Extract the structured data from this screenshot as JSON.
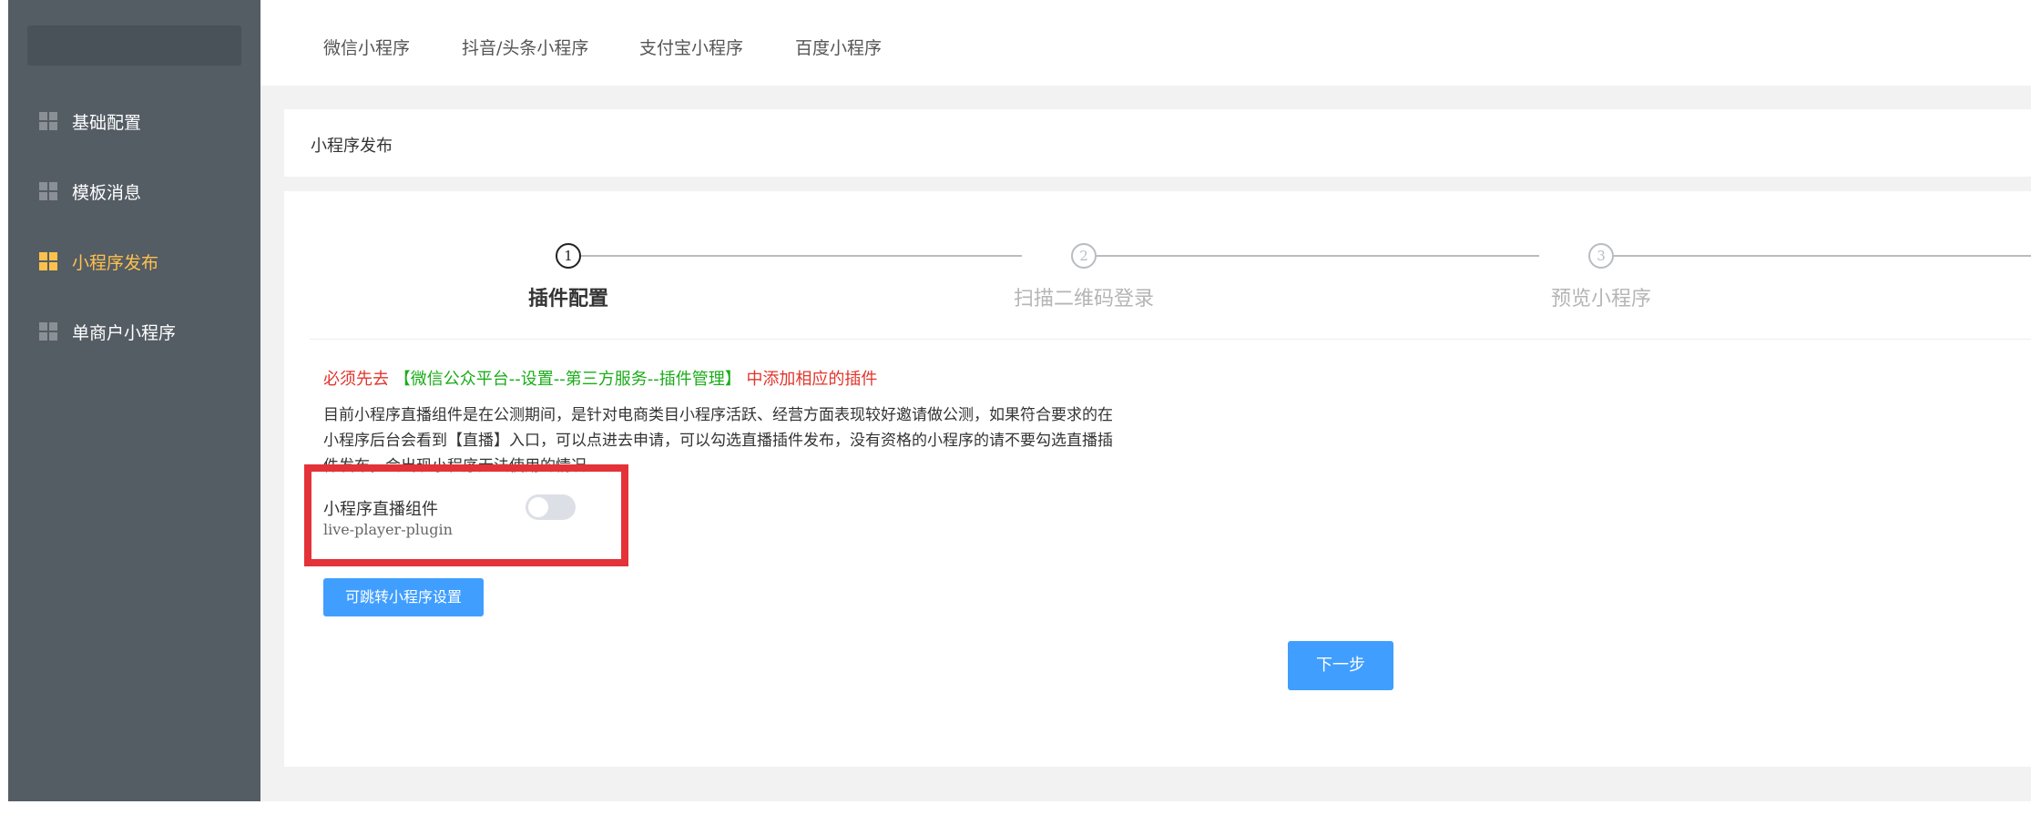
{
  "sidebar": {
    "items": [
      {
        "label": "基础配置"
      },
      {
        "label": "模板消息"
      },
      {
        "label": "小程序发布"
      },
      {
        "label": "单商户小程序"
      }
    ],
    "active_index": 2
  },
  "topbar": {
    "tabs": [
      {
        "label": "微信小程序"
      },
      {
        "label": "抖音/头条小程序"
      },
      {
        "label": "支付宝小程序"
      },
      {
        "label": "百度小程序"
      }
    ]
  },
  "breadcrumb": {
    "title": "小程序发布"
  },
  "steps": [
    {
      "number": "1",
      "label": "插件配置",
      "active": true
    },
    {
      "number": "2",
      "label": "扫描二维码登录",
      "active": false
    },
    {
      "number": "3",
      "label": "预览小程序",
      "active": false
    }
  ],
  "notice": {
    "prefix": "必须先去",
    "link": "【微信公众平台--设置--第三方服务--插件管理】",
    "suffix": "中添加相应的插件",
    "description": "目前小程序直播组件是在公测期间，是针对电商类目小程序活跃、经营方面表现较好邀请做公测，如果符合要求的在小程序后台会看到【直播】入口，可以点进去申请，可以勾选直播插件发布，没有资格的小程序的请不要勾选直播插件发布，会出现小程序无法使用的情况"
  },
  "plugin": {
    "name": "小程序直播组件",
    "code": "live-player-plugin",
    "enabled": false
  },
  "buttons": {
    "jump_label": "可跳转小程序设置",
    "next_label": "下一步"
  },
  "colors": {
    "sidebar_bg": "#545c64",
    "active": "#ffc14d",
    "primary": "#409eff",
    "warn": "#e2352b",
    "link": "#1aad19",
    "highlight": "#e33238"
  }
}
